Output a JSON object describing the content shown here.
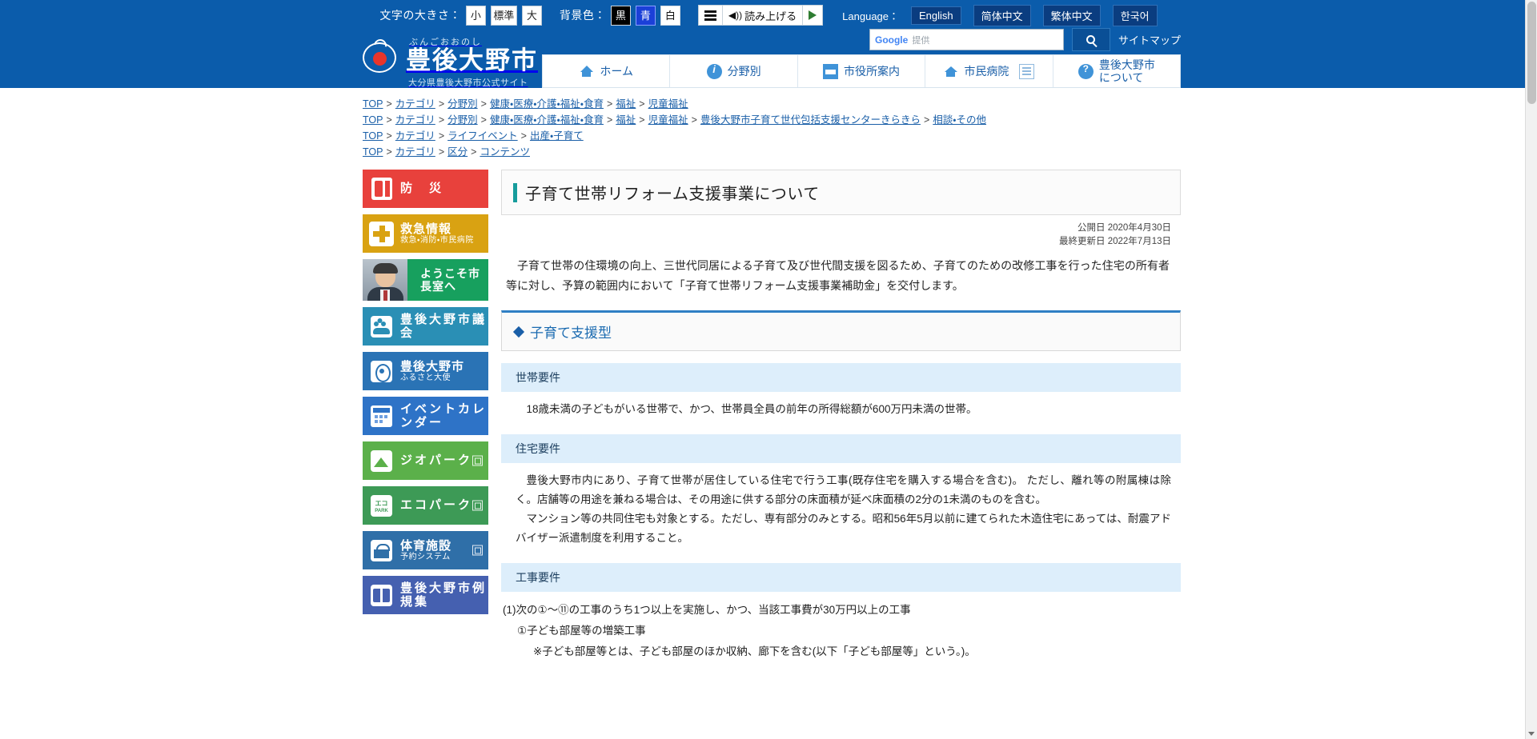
{
  "utility": {
    "font_size_label": "文字の大きさ：",
    "font_sizes": [
      "小",
      "標準",
      "大"
    ],
    "bg_label": "背景色：",
    "bg_colors": [
      "黒",
      "青",
      "白"
    ],
    "speech_label": "読み上げる",
    "language_label": "Language：",
    "languages": [
      "English",
      "简体中文",
      "繁体中文",
      "한국어"
    ]
  },
  "header": {
    "furigana": "ぶんごおおのし",
    "city_name": "豊後大野市",
    "tagline": "大分県豊後大野市公式サイト",
    "search_brand": "Google",
    "search_provided": "提供",
    "search_placeholder": "",
    "sitemap": "サイトマップ",
    "nav": [
      {
        "label": "ホーム",
        "icon": "home-icon"
      },
      {
        "label": "分野別",
        "icon": "info-circle-icon"
      },
      {
        "label": "市役所案内",
        "icon": "building-icon"
      },
      {
        "label": "市民病院",
        "icon": "hospital-icon"
      },
      {
        "label": "豊後大野市\nについて",
        "line1": "豊後大野市",
        "line2": "について",
        "icon": "question-circle-icon"
      }
    ]
  },
  "breadcrumbs": [
    [
      "TOP",
      "カテゴリ",
      "分野別",
      "健康・医療・介護・福祉・食育",
      "福祉",
      "児童福祉"
    ],
    [
      "TOP",
      "カテゴリ",
      "分野別",
      "健康・医療・介護・福祉・食育",
      "福祉",
      "児童福祉",
      "豊後大野市子育て世代包括支援センターきらきら",
      "相談・その他"
    ],
    [
      "TOP",
      "カテゴリ",
      "ライフイベント",
      "出産・子育て"
    ],
    [
      "TOP",
      "カテゴリ",
      "区分",
      "コンテンツ"
    ]
  ],
  "sidebar": {
    "banners": [
      {
        "title": "防　災",
        "sub": "",
        "icon": "emergency-exit-icon",
        "theme": "bn-bosai",
        "external": false
      },
      {
        "title": "救急情報",
        "sub": "救急・消防・市民病院",
        "icon": "medical-cross-icon",
        "theme": "bn-kyukyu",
        "external": false
      },
      {
        "title": "ようこそ市長室へ",
        "sub": "",
        "icon": "mayor-photo",
        "theme": "bn-mayor",
        "external": false
      },
      {
        "title": "豊後大野市議会",
        "sub": "",
        "icon": "people-icon",
        "theme": "bn-gikai",
        "external": false
      },
      {
        "title": "豊後大野市",
        "sub": "ふるさと大使",
        "icon": "furusato-icon",
        "theme": "bn-furusato",
        "external": false
      },
      {
        "title": "イベントカレンダー",
        "sub": "",
        "icon": "calendar-icon",
        "theme": "bn-event",
        "external": false
      },
      {
        "title": "ジオパーク",
        "sub": "",
        "icon": "geopark-icon",
        "theme": "bn-geo",
        "external": true
      },
      {
        "title": "エコパーク",
        "sub": "",
        "icon": "ecopark-icon",
        "theme": "bn-eco",
        "external": true
      },
      {
        "title": "体育施設",
        "sub": "予約システム",
        "icon": "stadium-icon",
        "theme": "bn-taiiku",
        "external": true
      },
      {
        "title": "豊後大野市例規集",
        "sub": "",
        "icon": "book-icon",
        "theme": "bn-reiki",
        "external": false
      }
    ]
  },
  "content": {
    "title": "子育て世帯リフォーム支援事業について",
    "published_label": "公開日",
    "published_date": "2020年4月30日",
    "updated_label": "最終更新日",
    "updated_date": "2022年7月13日",
    "lead": "子育て世帯の住環境の向上、三世代同居による子育て及び世代間支援を図るため、子育てのための改修工事を行った住宅の所有者等に対し、予算の範囲内において「子育て世帯リフォーム支援事業補助金」を交付します。",
    "section_title": "子育て支援型",
    "sections": [
      {
        "heading": "世帯要件",
        "paragraphs": [
          "18歳未満の子どもがいる世帯で、かつ、世帯員全員の前年の所得総額が600万円未満の世帯。"
        ]
      },
      {
        "heading": "住宅要件",
        "paragraphs": [
          "豊後大野市内にあり、子育て世帯が居住している住宅で行う工事(既存住宅を購入する場合を含む)。 ただし、離れ等の附属棟は除く。店舗等の用途を兼ねる場合は、その用途に供する部分の床面積が延べ床面積の2分の1未満のものを含む。",
          "マンション等の共同住宅も対象とする。ただし、専有部分のみとする。昭和56年5月以前に建てられた木造住宅にあっては、耐震アドバイザー派遣制度を利用すること。"
        ]
      },
      {
        "heading": "工事要件",
        "lines": [
          {
            "level": 1,
            "text": "(1)次の①〜⑪の工事のうち1つ以上を実施し、かつ、当該工事費が30万円以上の工事"
          },
          {
            "level": 2,
            "text": "①子ども部屋等の増築工事"
          },
          {
            "level": 3,
            "text": "※子ども部屋等とは、子ども部屋のほか収納、廊下を含む(以下「子ども部屋等」という。)。"
          }
        ]
      }
    ]
  },
  "colors": {
    "brand_blue": "#0b5cab",
    "accent_teal": "#179c9c",
    "link_blue": "#1a5fa8",
    "section_blue": "#2f7fc4",
    "subhead_bg": "#ddeefb"
  }
}
